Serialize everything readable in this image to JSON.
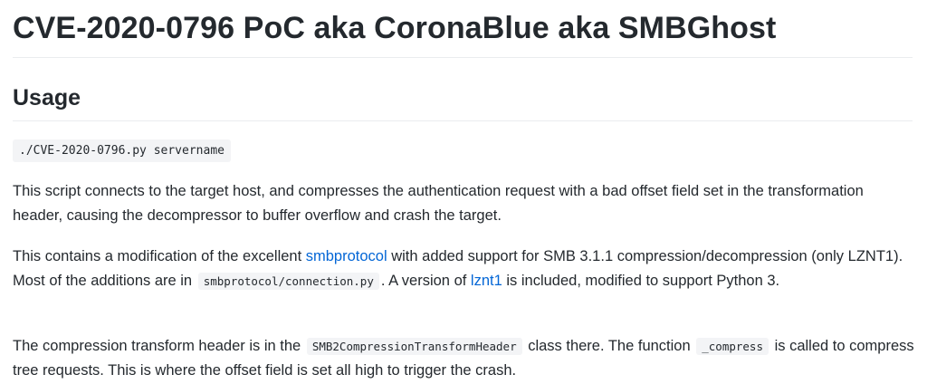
{
  "title": "CVE-2020-0796 PoC aka CoronaBlue aka SMBGhost",
  "usage": {
    "heading": "Usage",
    "command": "./CVE-2020-0796.py servername"
  },
  "paragraphs": {
    "p1": "This script connects to the target host, and compresses the authentication request with a bad offset field set in the transformation header, causing the decompressor to buffer overflow and crash the target.",
    "p2": {
      "t1": "This contains a modification of the excellent ",
      "link1": "smbprotocol",
      "t2": " with added support for SMB 3.1.1 compression/decompression (only LZNT1). Most of the additions are in ",
      "code1": "smbprotocol/connection.py",
      "t3": ". A version of ",
      "link2": "lznt1",
      "t4": " is included, modified to support Python 3."
    },
    "p3": {
      "t1": "The compression transform header is in the ",
      "code1": "SMB2CompressionTransformHeader",
      "t2": " class there. The function ",
      "code2": "_compress",
      "t3": " is called to compress tree requests. This is where the offset field is set all high to trigger the crash."
    }
  },
  "colors": {
    "text": "#24292e",
    "link": "#0366d6",
    "code_background": "#f3f4f6",
    "rule": "#eaecef"
  }
}
